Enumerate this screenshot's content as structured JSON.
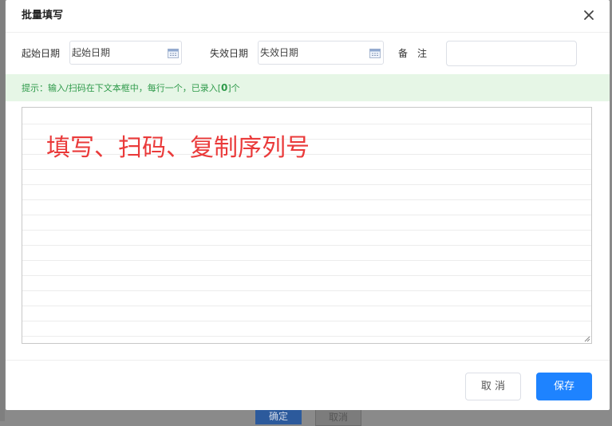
{
  "background": {
    "primary_button_label": "确定",
    "secondary_button_label": "取消"
  },
  "dialog": {
    "title": "批量填写",
    "close_icon": "close-icon"
  },
  "form": {
    "start_date": {
      "label": "起始日期",
      "placeholder": "起始日期",
      "value": ""
    },
    "end_date": {
      "label": "失效日期",
      "placeholder": "失效日期",
      "value": ""
    },
    "remark": {
      "label": "备　注",
      "value": ""
    }
  },
  "tip": {
    "text_before": "提示：输入/扫码在下文本框中，每行一个，已录入[",
    "count": "0",
    "text_after": "]个",
    "color": "#2e9a4a",
    "background": "#e6f6e6"
  },
  "textarea": {
    "value": "",
    "overlay_hint": "填写、扫码、复制序列号",
    "overlay_color": "#ea3a3a"
  },
  "footer": {
    "cancel_label": "取 消",
    "save_label": "保存",
    "accent_color": "#1e83ff"
  }
}
